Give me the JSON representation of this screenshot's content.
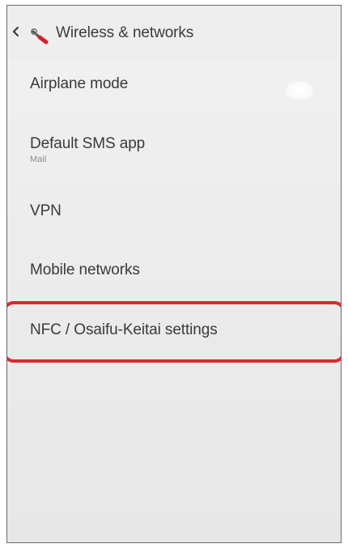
{
  "header": {
    "title": "Wireless & networks",
    "back_icon": "chevron-left-icon",
    "app_icon": "settings-wrench-icon"
  },
  "items": [
    {
      "label": "Airplane mode",
      "subtitle": "",
      "toggle": "off"
    },
    {
      "label": "Default SMS app",
      "subtitle": "Mail"
    },
    {
      "label": "VPN"
    },
    {
      "label": "Mobile networks"
    },
    {
      "label": "NFC / Osaifu-Keitai settings",
      "highlighted": true
    }
  ],
  "colors": {
    "highlight": "#e0262d",
    "background": "#ececec",
    "text": "#3a3a3a"
  }
}
